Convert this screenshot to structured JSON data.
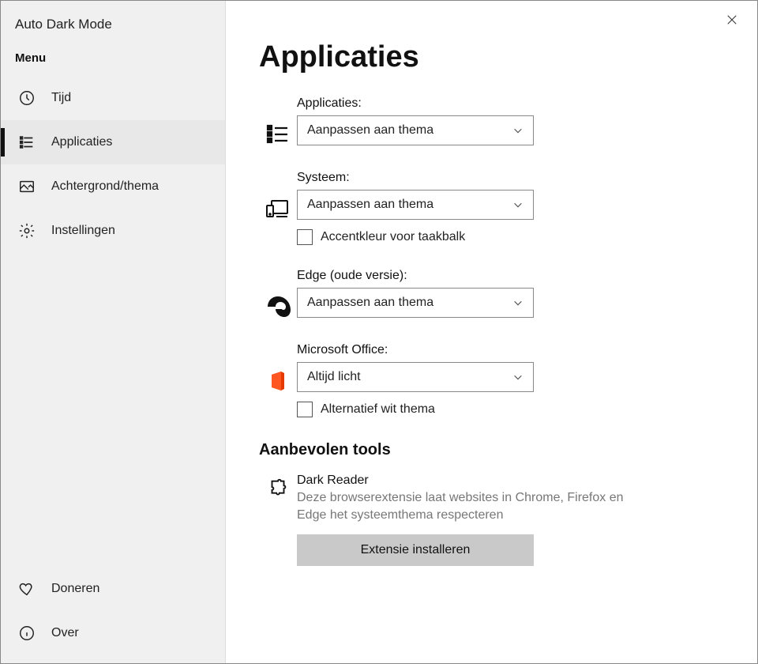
{
  "app_title": "Auto Dark Mode",
  "menu_label": "Menu",
  "close_x": "",
  "nav": {
    "time": "Tijd",
    "apps": "Applicaties",
    "background": "Achtergrond/thema",
    "settings": "Instellingen",
    "donate": "Doneren",
    "about": "Over"
  },
  "page": {
    "heading": "Applicaties",
    "sections": {
      "apps": {
        "label": "Applicaties:",
        "value": "Aanpassen aan thema"
      },
      "system": {
        "label": "Systeem:",
        "value": "Aanpassen aan thema",
        "checkbox": "Accentkleur voor taakbalk"
      },
      "edge": {
        "label": "Edge (oude versie):",
        "value": "Aanpassen aan thema"
      },
      "office": {
        "label": "Microsoft Office:",
        "value": "Altijd licht",
        "checkbox": "Alternatief wit thema"
      }
    },
    "tools_heading": "Aanbevolen tools",
    "tool": {
      "title": "Dark Reader",
      "desc": "Deze browserextensie laat websites in Chrome, Firefox en Edge het systeemthema respecteren",
      "button": "Extensie installeren"
    }
  }
}
